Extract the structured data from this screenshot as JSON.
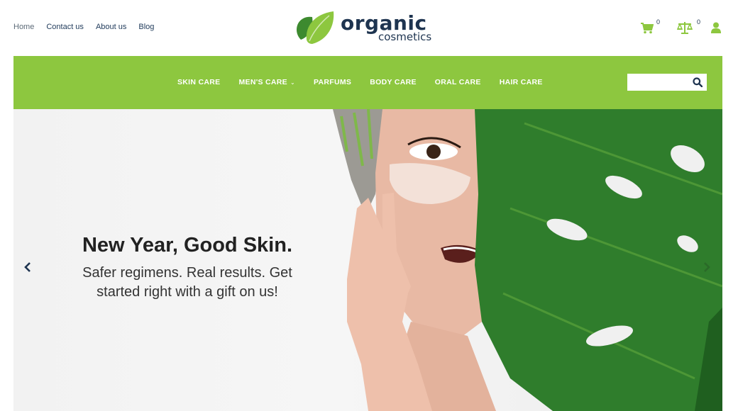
{
  "topnav": {
    "links": [
      "Home",
      "Contact us",
      "About us",
      "Blog"
    ]
  },
  "logo": {
    "main": "organic",
    "sub": "cosmetics"
  },
  "header_icons": {
    "cart_count": "0",
    "compare_count": "0"
  },
  "nav": {
    "categories": [
      "SKIN CARE",
      "MEN'S CARE",
      "PARFUMS",
      "BODY CARE",
      "ORAL CARE",
      "HAIR CARE"
    ],
    "dropdown_index": 1
  },
  "search": {
    "placeholder": "",
    "value": ""
  },
  "hero": {
    "title": "New Year, Good Skin.",
    "subtitle_line1": "Safer regimens. Real results. Get",
    "subtitle_line2": "started right with a gift on us!"
  },
  "colors": {
    "brand_green": "#8dc73f",
    "navy": "#1e3450",
    "leaf_green": "#2f7d2c"
  }
}
